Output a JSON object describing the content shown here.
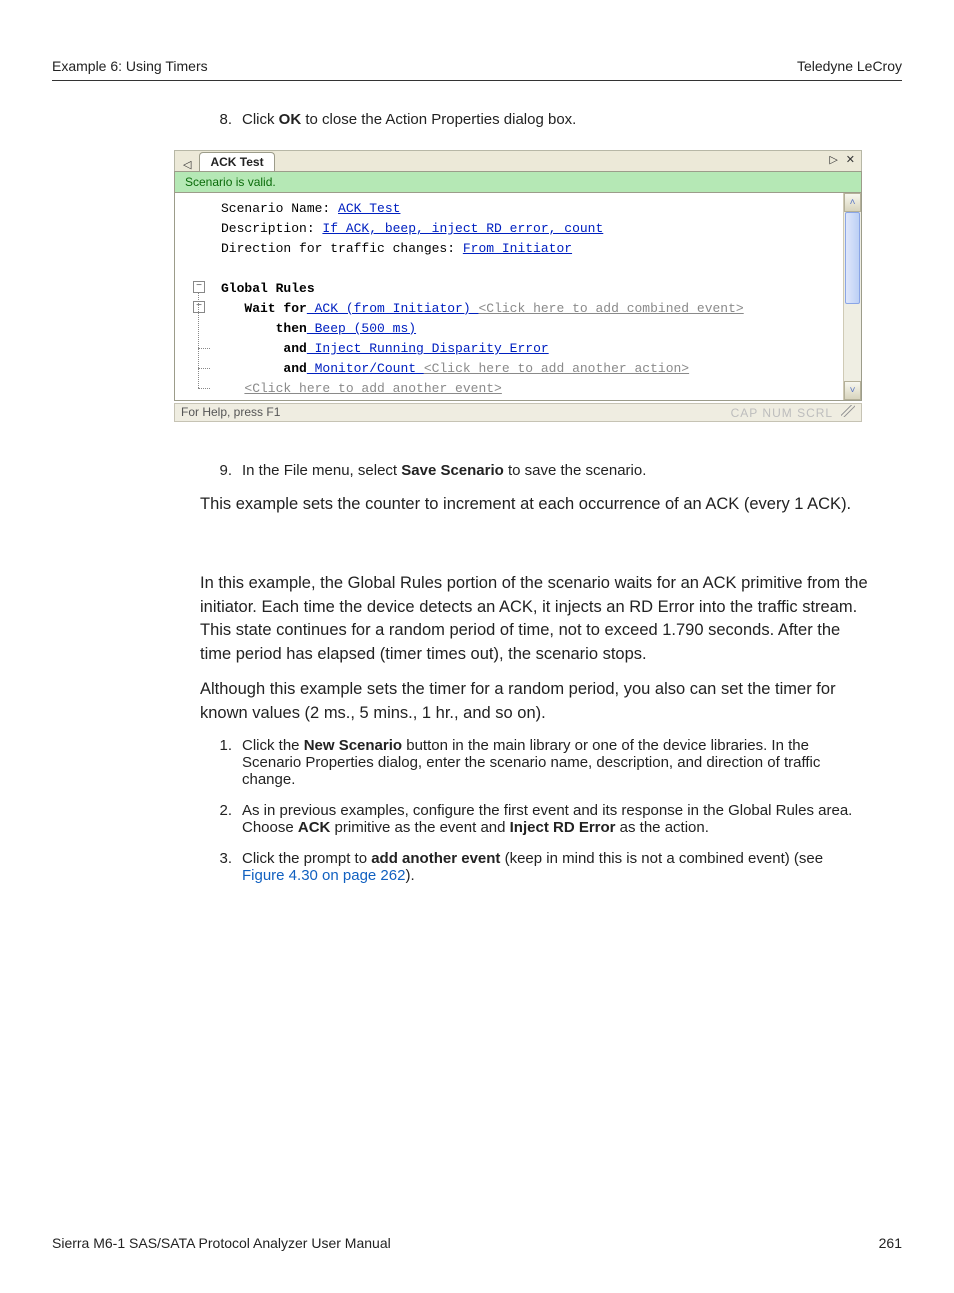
{
  "header": {
    "left": "Example 6: Using Timers",
    "right": "Teledyne LeCroy"
  },
  "footer": {
    "left": "Sierra M6-1 SAS/SATA Protocol Analyzer User Manual",
    "right": "261"
  },
  "steps_a": [
    {
      "n": "8.",
      "plain_before": "Click ",
      "bold": "OK",
      "plain_after": " to close the Action Properties dialog box."
    }
  ],
  "screenshot": {
    "tab": "ACK Test",
    "valid": "Scenario is valid.",
    "lines": {
      "l1a": "Scenario Name: ",
      "l1b": "ACK Test",
      "l2a": "Description: ",
      "l2b": "If ACK, beep, inject RD error, count",
      "l3a": "Direction for traffic changes: ",
      "l3b": "From Initiator",
      "l4": "Global Rules",
      "l5a": "Wait for",
      "l5b": " ACK (from Initiator) ",
      "l5c": "<Click here to add combined event>",
      "l6a": "then",
      "l6b": " Beep (500 ms)",
      "l7a": "and",
      "l7b": " Inject Running Disparity Error",
      "l8a": "and",
      "l8b": " Monitor/Count ",
      "l8c": "<Click here to add another action>",
      "l9": "<Click here to add another event>"
    },
    "status_left": "For Help, press F1",
    "status_right": "CAP  NUM  SCRL"
  },
  "steps_b": [
    {
      "n": "9.",
      "html": "In the File menu, select <b>Save Scenario</b> to save the scenario."
    }
  ],
  "para1": "This example sets the counter to increment at each occurrence of an ACK (every 1 ACK).",
  "para2": "In this example, the Global Rules portion of the scenario waits for an ACK primitive from the initiator. Each time the device detects an ACK, it injects an RD Error into the traffic stream. This state continues for a random period of time, not to exceed 1.790 seconds. After the time period has elapsed (timer times out), the scenario stops.",
  "para3": "Although this example sets the timer for a random period, you also can set the timer for known values (2 ms., 5 mins., 1 hr., and so on).",
  "steps_c": [
    {
      "n": "1.",
      "html": "Click the <b>New Scenario</b> button in the main library or one of the device libraries. In the Scenario Properties dialog, enter the scenario name, description, and direction of traffic change."
    },
    {
      "n": "2.",
      "html": "As in previous examples, configure the first event and its response in the Global Rules area. Choose <b>ACK</b> primitive as the event and <b>Inject RD Error</b> as the action."
    },
    {
      "n": "3.",
      "html": "Click the prompt to <b>add another event</b> (keep in mind this is not a combined event) (see <a class='xref' href='#'>Figure 4.30 on page 262</a>)."
    }
  ]
}
